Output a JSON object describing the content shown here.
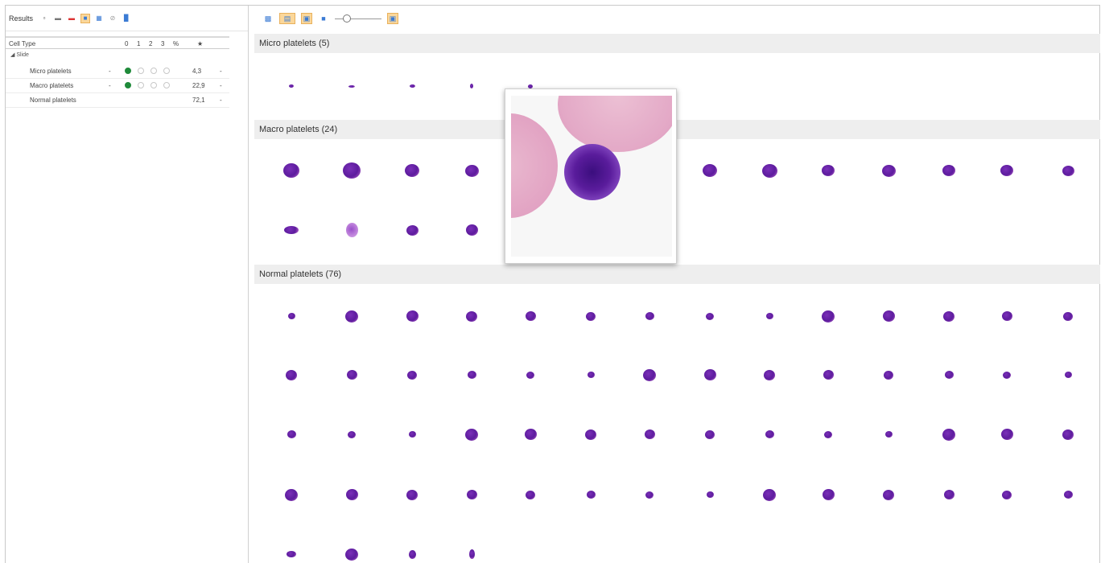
{
  "left_toolbar": {
    "title": "Results"
  },
  "grid": {
    "columns": [
      "Cell Type",
      "0",
      "1",
      "2",
      "3",
      "%",
      "★"
    ],
    "group": "Slide",
    "rows": [
      {
        "name": "Micro platelets",
        "grade": "0",
        "percent": "4,3"
      },
      {
        "name": "Macro platelets",
        "grade": "0",
        "percent": "22,9"
      },
      {
        "name": "Normal platelets",
        "grade": "",
        "percent": "72,1"
      }
    ]
  },
  "sections": {
    "micro": "Micro platelets (5)",
    "macro": "Macro platelets (24)",
    "normal": "Normal platelets (76)"
  },
  "colors": {
    "cell": "#5d1c9e",
    "selected_tool": "#fbd79a",
    "grade_on": "#1f8a3a"
  }
}
